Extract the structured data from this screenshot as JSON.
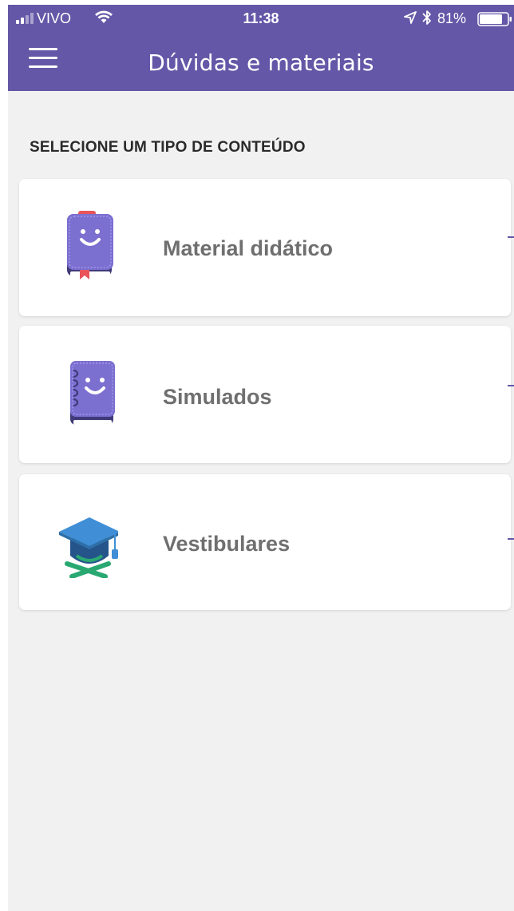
{
  "status_bar": {
    "carrier": "VIVO",
    "time": "11:38",
    "battery": "81%",
    "icons": [
      "signal-icon",
      "wifi-icon",
      "location-icon",
      "bluetooth-icon",
      "battery-icon"
    ]
  },
  "header": {
    "title": "Dúvidas e materiais",
    "menu_icon": "hamburger-menu-icon"
  },
  "main": {
    "section_heading": "SELECIONE UM TIPO DE CONTEÚDO",
    "cards": [
      {
        "label": "Material didático",
        "icon": "book-icon"
      },
      {
        "label": "Simulados",
        "icon": "notebook-icon"
      },
      {
        "label": "Vestibulares",
        "icon": "graduation-cap-icon"
      }
    ]
  },
  "colors": {
    "header_bg": "#6557a7",
    "screen_bg": "#f1f1f1",
    "card_bg": "#ffffff",
    "label_text": "#6f6f6f",
    "icon_purple": "#7b6fd0",
    "icon_red": "#e8545a",
    "cap_blue": "#2f6fa8",
    "ribbon_green": "#2aa872"
  }
}
